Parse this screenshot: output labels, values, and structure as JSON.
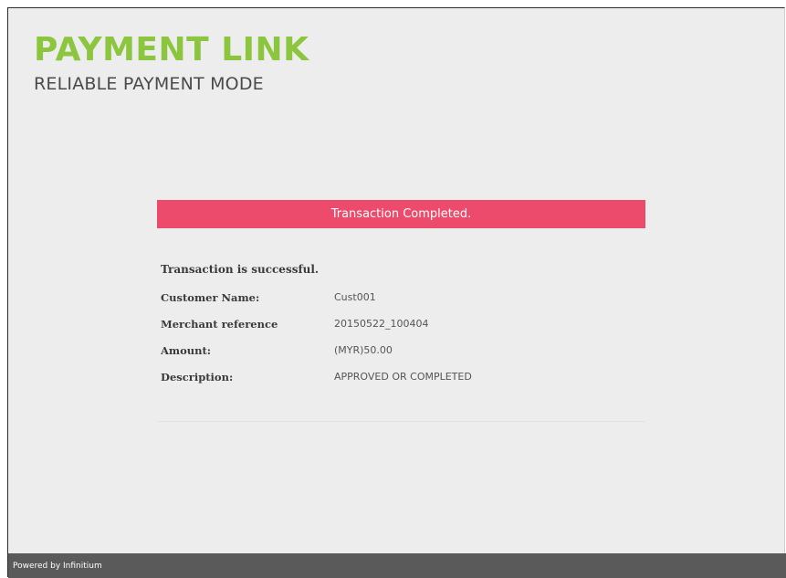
{
  "brand": {
    "title": "PAYMENT LINK",
    "subtitle": "RELIABLE PAYMENT MODE"
  },
  "status": {
    "banner": "Transaction Completed.",
    "message": "Transaction is successful."
  },
  "details": [
    {
      "label": "Customer Name:",
      "value": "Cust001"
    },
    {
      "label": "Merchant reference",
      "value": "20150522_100404"
    },
    {
      "label": "Amount:",
      "value": "(MYR)50.00"
    },
    {
      "label": "Description:",
      "value": "APPROVED OR COMPLETED"
    }
  ],
  "footer": {
    "text": "Powered by Infinitium"
  },
  "colors": {
    "brand_green": "#8cc63f",
    "banner_pink": "#ed4b6b",
    "footer_gray": "#5a5a5a",
    "page_bg": "#ededed"
  }
}
